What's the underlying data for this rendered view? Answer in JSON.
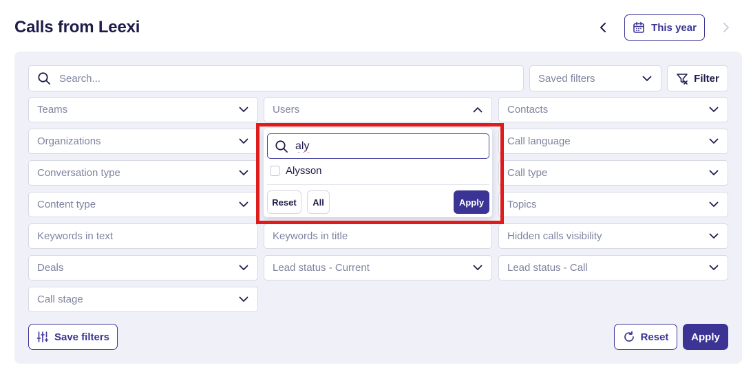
{
  "header": {
    "title": "Calls from Leexi",
    "date_range_label": "This year"
  },
  "search": {
    "placeholder": "Search..."
  },
  "saved_filters": {
    "label": "Saved filters"
  },
  "filter_button": {
    "label": "Filter"
  },
  "filters": {
    "teams": "Teams",
    "users": "Users",
    "contacts": "Contacts",
    "organizations": "Organizations",
    "call_language": "Call language",
    "conversation_type": "Conversation type",
    "call_type": "Call type",
    "content_type": "Content type",
    "topics": "Topics",
    "keywords_text": "Keywords in text",
    "keywords_title": "Keywords in title",
    "hidden_calls": "Hidden calls visibility",
    "deals": "Deals",
    "lead_status_current": "Lead status - Current",
    "lead_status_call": "Lead status - Call",
    "call_stage": "Call stage"
  },
  "users_dropdown": {
    "search_value": "aly",
    "options": [
      {
        "label": "Alysson",
        "checked": false
      }
    ],
    "reset_label": "Reset",
    "all_label": "All",
    "apply_label": "Apply"
  },
  "footer": {
    "save_filters_label": "Save filters",
    "reset_label": "Reset",
    "apply_label": "Apply"
  },
  "colors": {
    "primary": "#3b3494",
    "panel_bg": "#f0f1f8",
    "highlight": "#e01b1b"
  }
}
